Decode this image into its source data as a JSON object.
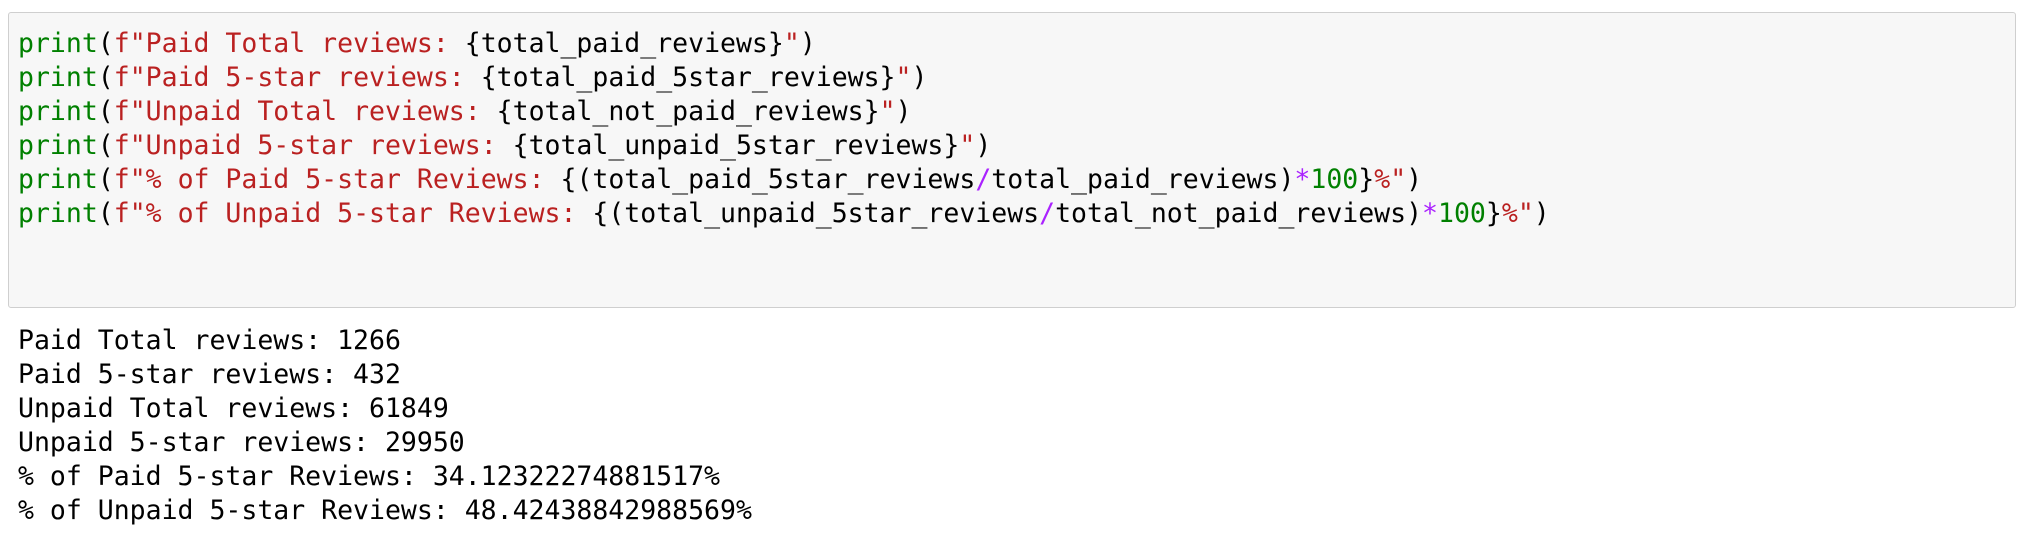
{
  "code_cell": {
    "lines": [
      [
        {
          "t": "print",
          "c": "kw"
        },
        {
          "t": "(",
          "c": "plain"
        },
        {
          "t": "f\"Paid Total reviews: ",
          "c": "str"
        },
        {
          "t": "{total_paid_reviews}",
          "c": "plain"
        },
        {
          "t": "\"",
          "c": "str"
        },
        {
          "t": ")",
          "c": "plain"
        }
      ],
      [
        {
          "t": "print",
          "c": "kw"
        },
        {
          "t": "(",
          "c": "plain"
        },
        {
          "t": "f\"Paid 5-star reviews: ",
          "c": "str"
        },
        {
          "t": "{total_paid_5star_reviews}",
          "c": "plain"
        },
        {
          "t": "\"",
          "c": "str"
        },
        {
          "t": ")",
          "c": "plain"
        }
      ],
      [
        {
          "t": "print",
          "c": "kw"
        },
        {
          "t": "(",
          "c": "plain"
        },
        {
          "t": "f\"Unpaid Total reviews: ",
          "c": "str"
        },
        {
          "t": "{total_not_paid_reviews}",
          "c": "plain"
        },
        {
          "t": "\"",
          "c": "str"
        },
        {
          "t": ")",
          "c": "plain"
        }
      ],
      [
        {
          "t": "print",
          "c": "kw"
        },
        {
          "t": "(",
          "c": "plain"
        },
        {
          "t": "f\"Unpaid 5-star reviews: ",
          "c": "str"
        },
        {
          "t": "{total_unpaid_5star_reviews}",
          "c": "plain"
        },
        {
          "t": "\"",
          "c": "str"
        },
        {
          "t": ")",
          "c": "plain"
        }
      ],
      [
        {
          "t": "print",
          "c": "kw"
        },
        {
          "t": "(",
          "c": "plain"
        },
        {
          "t": "f\"% of Paid 5-star Reviews: ",
          "c": "str"
        },
        {
          "t": "{(total_paid_5star_reviews",
          "c": "plain"
        },
        {
          "t": "/",
          "c": "op"
        },
        {
          "t": "total_paid_reviews)",
          "c": "plain"
        },
        {
          "t": "*",
          "c": "op"
        },
        {
          "t": "100",
          "c": "num"
        },
        {
          "t": "}",
          "c": "plain"
        },
        {
          "t": "%\"",
          "c": "str"
        },
        {
          "t": ")",
          "c": "plain"
        }
      ],
      [
        {
          "t": "print",
          "c": "kw"
        },
        {
          "t": "(",
          "c": "plain"
        },
        {
          "t": "f\"% of Unpaid 5-star Reviews: ",
          "c": "str"
        },
        {
          "t": "{(total_unpaid_5star_reviews",
          "c": "plain"
        },
        {
          "t": "/",
          "c": "op"
        },
        {
          "t": "total_not_paid_reviews)",
          "c": "plain"
        },
        {
          "t": "*",
          "c": "op"
        },
        {
          "t": "100",
          "c": "num"
        },
        {
          "t": "}",
          "c": "plain"
        },
        {
          "t": "%\"",
          "c": "str"
        },
        {
          "t": ")",
          "c": "plain"
        }
      ]
    ]
  },
  "output": {
    "lines": [
      "Paid Total reviews: 1266",
      "Paid 5-star reviews: 432",
      "Unpaid Total reviews: 61849",
      "Unpaid 5-star reviews: 29950",
      "% of Paid 5-star Reviews: 34.12322274881517%",
      "% of Unpaid 5-star Reviews: 48.42438842988569%"
    ]
  },
  "colors": {
    "keyword": "#008000",
    "string": "#ba2121",
    "operator": "#aa22ff",
    "number": "#008000",
    "cell_background": "#f7f7f7",
    "cell_border": "#cfcfcf"
  }
}
